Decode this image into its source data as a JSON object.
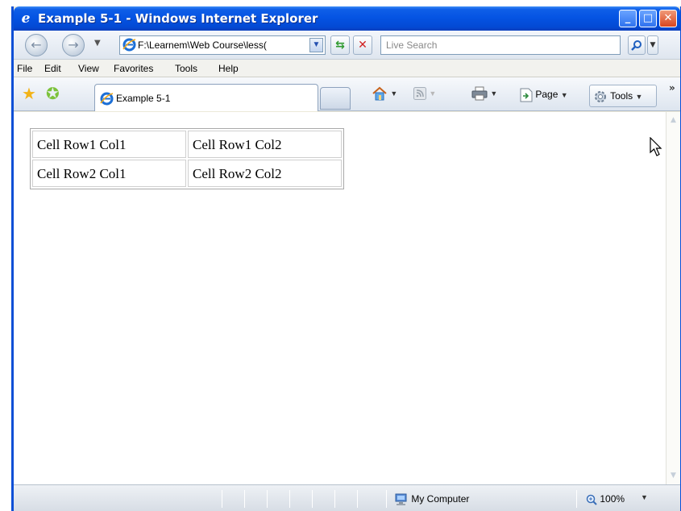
{
  "window": {
    "title": "Example 5-1 - Windows Internet Explorer",
    "minimize_glyph": "_",
    "maximize_glyph": "□",
    "close_glyph": "✕"
  },
  "address_bar": {
    "value": "F:\\Learnem\\Web Course\\less(",
    "search_placeholder": "Live Search"
  },
  "menu": {
    "items": [
      "File",
      "Edit",
      "View",
      "Favorites",
      "Tools",
      "Help"
    ]
  },
  "tabs": [
    {
      "label": "Example 5-1"
    }
  ],
  "command_bar": {
    "page_label": "Page",
    "tools_label": "Tools"
  },
  "page_table": {
    "rows": [
      [
        "Cell Row1 Col1",
        "Cell Row1 Col2"
      ],
      [
        "Cell Row2 Col1",
        "Cell Row2 Col2"
      ]
    ]
  },
  "status_bar": {
    "zone": "My Computer",
    "zoom": "100%"
  },
  "icons": {
    "ie": "internet-explorer-icon",
    "back": "back-arrow-icon",
    "forward": "forward-arrow-icon",
    "refresh": "refresh-icon",
    "stop": "stop-icon",
    "search": "magnifier-icon",
    "favorites": "star-icon",
    "add_favorites": "add-favorites-icon",
    "home": "home-icon",
    "feeds": "feeds-icon",
    "print": "printer-icon",
    "page": "page-icon",
    "tools": "gear-icon",
    "zone": "my-computer-icon",
    "zoom": "zoom-icon"
  },
  "colors": {
    "titlebar": "#0554e3",
    "window_frame": "#ece9d8"
  }
}
